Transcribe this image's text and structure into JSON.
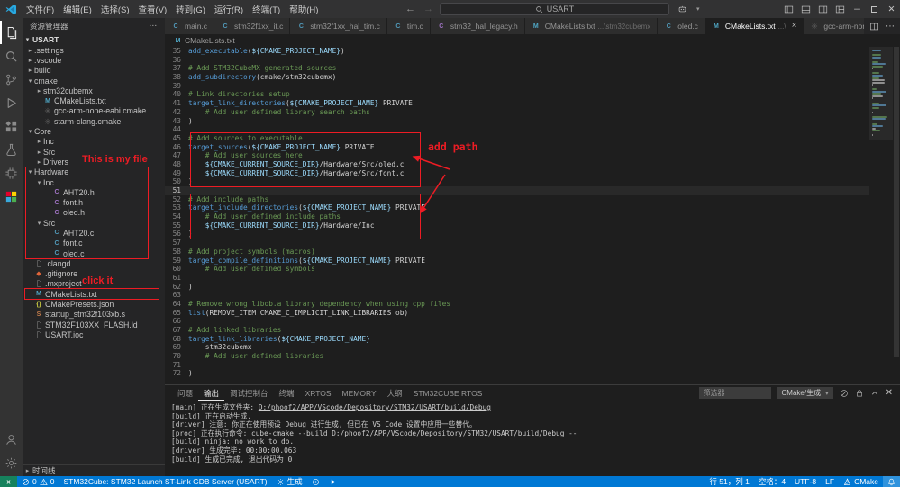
{
  "colors": {
    "annotation_red": "#ed1c24",
    "statusbar": "#0078d4",
    "accent": "#0078d4"
  },
  "window": {
    "menus": [
      "文件(F)",
      "编辑(E)",
      "选择(S)",
      "查看(V)",
      "转到(G)",
      "运行(R)",
      "终端(T)",
      "帮助(H)"
    ],
    "search_value": "USART"
  },
  "activity_bar": {
    "top": [
      {
        "name": "explorer",
        "active": true
      },
      {
        "name": "search"
      },
      {
        "name": "source-control"
      },
      {
        "name": "run-debug"
      },
      {
        "name": "extensions"
      },
      {
        "name": "testing"
      },
      {
        "name": "stm32-chip"
      },
      {
        "name": "stm32cube"
      }
    ],
    "bottom": [
      {
        "name": "account"
      },
      {
        "name": "settings"
      }
    ]
  },
  "sidebar": {
    "title": "资源管理器",
    "actions": "⋯",
    "section": "USART",
    "timeline_label": "时间线",
    "note_file": "This is my file",
    "note_click": "click it",
    "tree": [
      {
        "l": ".settings",
        "d": 0,
        "ch": "r"
      },
      {
        "l": ".vscode",
        "d": 0,
        "ch": "r"
      },
      {
        "l": "build",
        "d": 0,
        "ch": "r"
      },
      {
        "l": "cmake",
        "d": 0,
        "ch": "d"
      },
      {
        "l": "stm32cubemx",
        "d": 1,
        "ch": "r"
      },
      {
        "l": "CMakeLists.txt",
        "d": 1,
        "t": "cmake"
      },
      {
        "l": "gcc-arm-none-eabi.cmake",
        "d": 1,
        "t": "gear"
      },
      {
        "l": "starm-clang.cmake",
        "d": 1,
        "t": "gear"
      },
      {
        "l": "Core",
        "d": 0,
        "ch": "d"
      },
      {
        "l": "Inc",
        "d": 1,
        "ch": "r"
      },
      {
        "l": "Src",
        "d": 1,
        "ch": "r"
      },
      {
        "l": "Drivers",
        "d": 1,
        "ch": "r"
      },
      {
        "l": "Hardware",
        "d": 0,
        "ch": "d"
      },
      {
        "l": "Inc",
        "d": 1,
        "ch": "d"
      },
      {
        "l": "AHT20.h",
        "d": 2,
        "t": "h"
      },
      {
        "l": "font.h",
        "d": 2,
        "t": "h"
      },
      {
        "l": "oled.h",
        "d": 2,
        "t": "h"
      },
      {
        "l": "Src",
        "d": 1,
        "ch": "d"
      },
      {
        "l": "AHT20.c",
        "d": 2,
        "t": "c"
      },
      {
        "l": "font.c",
        "d": 2,
        "t": "c"
      },
      {
        "l": "oled.c",
        "d": 2,
        "t": "c"
      },
      {
        "l": ".clangd",
        "d": 0,
        "t": "file"
      },
      {
        "l": ".gitignore",
        "d": 0,
        "t": "git"
      },
      {
        "l": ".mxproject",
        "d": 0,
        "t": "file"
      },
      {
        "l": "CMakeLists.txt",
        "d": 0,
        "t": "cmake"
      },
      {
        "l": "CMakePresets.json",
        "d": 0,
        "t": "json"
      },
      {
        "l": "startup_stm32f103xb.s",
        "d": 0,
        "t": "asm"
      },
      {
        "l": "STM32F103XX_FLASH.ld",
        "d": 0,
        "t": "file"
      },
      {
        "l": "USART.ioc",
        "d": 0,
        "t": "file"
      }
    ]
  },
  "tabs": [
    {
      "icon": "c",
      "label": "main.c"
    },
    {
      "icon": "c",
      "label": "stm32f1xx_it.c"
    },
    {
      "icon": "c",
      "label": "stm32f1xx_hal_tim.c"
    },
    {
      "icon": "c",
      "label": "tim.c"
    },
    {
      "icon": "h",
      "label": "stm32_hal_legacy.h"
    },
    {
      "icon": "cmake",
      "label": "CMakeLists.txt",
      "suffix": "...\\stm32cubemx"
    },
    {
      "icon": "c",
      "label": "oled.c"
    },
    {
      "icon": "cmake",
      "label": "CMakeLists.txt",
      "suffix": "...\\",
      "active": true
    },
    {
      "icon": "gear",
      "label": "gcc-arm-none-eabi.cmake"
    }
  ],
  "breadcrumb": {
    "file": "CMakeLists.txt"
  },
  "editor": {
    "current_line": 51,
    "annotation": "add path",
    "lines": [
      {
        "n": 35,
        "s": [
          [
            "add_executable",
            "cmd"
          ],
          [
            "(",
            "pln"
          ],
          [
            "${CMAKE_PROJECT_NAME}",
            "var"
          ],
          [
            ")",
            "pln"
          ]
        ]
      },
      {
        "n": 36,
        "s": []
      },
      {
        "n": 37,
        "s": [
          [
            "# Add STM32CubeMX generated sources",
            "com"
          ]
        ]
      },
      {
        "n": 38,
        "s": [
          [
            "add_subdirectory",
            "cmd"
          ],
          [
            "(cmake/stm32cubemx)",
            "pln"
          ]
        ]
      },
      {
        "n": 39,
        "s": []
      },
      {
        "n": 40,
        "s": [
          [
            "# Link directories setup",
            "com"
          ]
        ]
      },
      {
        "n": 41,
        "s": [
          [
            "target_link_directories",
            "cmd"
          ],
          [
            "(",
            "pln"
          ],
          [
            "${CMAKE_PROJECT_NAME}",
            "var"
          ],
          [
            " PRIVATE",
            "pln"
          ]
        ]
      },
      {
        "n": 42,
        "s": [
          [
            "    # Add user defined library search paths",
            "com"
          ]
        ]
      },
      {
        "n": 43,
        "s": [
          [
            ")",
            "pln"
          ]
        ]
      },
      {
        "n": 44,
        "s": []
      },
      {
        "n": 45,
        "s": [
          [
            "# Add sources to executable",
            "com"
          ]
        ]
      },
      {
        "n": 46,
        "s": [
          [
            "target_sources",
            "cmd"
          ],
          [
            "(",
            "pln"
          ],
          [
            "${CMAKE_PROJECT_NAME}",
            "var"
          ],
          [
            " PRIVATE",
            "pln"
          ]
        ]
      },
      {
        "n": 47,
        "s": [
          [
            "    # Add user sources here",
            "com"
          ]
        ]
      },
      {
        "n": 48,
        "s": [
          [
            "    ",
            "pln"
          ],
          [
            "${CMAKE_CURRENT_SOURCE_DIR}",
            "var"
          ],
          [
            "/Hardware/Src/oled.c",
            "pln"
          ]
        ]
      },
      {
        "n": 49,
        "s": [
          [
            "    ",
            "pln"
          ],
          [
            "${CMAKE_CURRENT_SOURCE_DIR}",
            "var"
          ],
          [
            "/Hardware/Src/font.c",
            "pln"
          ]
        ]
      },
      {
        "n": 50,
        "s": [
          [
            ")",
            "pln"
          ]
        ]
      },
      {
        "n": 51,
        "s": []
      },
      {
        "n": 52,
        "s": [
          [
            "# Add include paths",
            "com"
          ]
        ]
      },
      {
        "n": 53,
        "s": [
          [
            "target_include_directories",
            "cmd"
          ],
          [
            "(",
            "pln"
          ],
          [
            "${CMAKE_PROJECT_NAME}",
            "var"
          ],
          [
            " PRIVATE",
            "pln"
          ]
        ]
      },
      {
        "n": 54,
        "s": [
          [
            "    # Add user defined include paths",
            "com"
          ]
        ]
      },
      {
        "n": 55,
        "s": [
          [
            "    ",
            "pln"
          ],
          [
            "${CMAKE_CURRENT_SOURCE_DIR}",
            "var"
          ],
          [
            "/Hardware/Inc",
            "pln"
          ]
        ]
      },
      {
        "n": 56,
        "s": [
          [
            ")",
            "pln"
          ]
        ]
      },
      {
        "n": 57,
        "s": []
      },
      {
        "n": 58,
        "s": [
          [
            "# Add project symbols (macros)",
            "com"
          ]
        ]
      },
      {
        "n": 59,
        "s": [
          [
            "target_compile_definitions",
            "cmd"
          ],
          [
            "(",
            "pln"
          ],
          [
            "${CMAKE_PROJECT_NAME}",
            "var"
          ],
          [
            " PRIVATE",
            "pln"
          ]
        ]
      },
      {
        "n": 60,
        "s": [
          [
            "    # Add user defined symbols",
            "com"
          ]
        ]
      },
      {
        "n": 61,
        "s": []
      },
      {
        "n": 62,
        "s": [
          [
            ")",
            "pln"
          ]
        ]
      },
      {
        "n": 63,
        "s": []
      },
      {
        "n": 64,
        "s": [
          [
            "# Remove wrong libob.a library dependency when using cpp files",
            "com"
          ]
        ]
      },
      {
        "n": 65,
        "s": [
          [
            "list",
            "cmd"
          ],
          [
            "(REMOVE_ITEM CMAKE_C_IMPLICIT_LINK_LIBRARIES ob)",
            "pln"
          ]
        ]
      },
      {
        "n": 66,
        "s": []
      },
      {
        "n": 67,
        "s": [
          [
            "# Add linked libraries",
            "com"
          ]
        ]
      },
      {
        "n": 68,
        "s": [
          [
            "target_link_libraries",
            "cmd"
          ],
          [
            "(",
            "pln"
          ],
          [
            "${CMAKE_PROJECT_NAME}",
            "var"
          ]
        ]
      },
      {
        "n": 69,
        "s": [
          [
            "    stm32cubemx",
            "pln"
          ]
        ]
      },
      {
        "n": 70,
        "s": [
          [
            "    # Add user defined libraries",
            "com"
          ]
        ]
      },
      {
        "n": 71,
        "s": []
      },
      {
        "n": 72,
        "s": [
          [
            ")",
            "pln"
          ]
        ]
      }
    ]
  },
  "panel": {
    "tabs": [
      "问题",
      "输出",
      "调试控制台",
      "终端",
      "XRTOS",
      "MEMORY",
      "大纲",
      "STM32CUBE RTOS"
    ],
    "active_tab": "输出",
    "filter_placeholder": "筛选器",
    "channel": "CMake/生成",
    "output_lines": [
      [
        [
          "[main] 正在生成文件夹: ",
          ""
        ],
        [
          "D:/phoof2/APP/VScode/Depository/STM32/USART/build/Debug",
          "link"
        ]
      ],
      [
        [
          "[build] 正在启动生成.",
          ""
        ]
      ],
      [
        [
          "[driver] 注意: 你正在使用预设 Debug 进行生成, 但已在 VS Code 设置中应用一些替代。",
          ""
        ]
      ],
      [
        [
          "[proc] 正在执行命令: cube-cmake --build ",
          ""
        ],
        [
          "D:/phoof2/APP/VScode/Depository/STM32/USART/build/Debug",
          "link"
        ],
        [
          " --",
          ""
        ]
      ],
      [
        [
          "[build] ninja: no work to do.",
          ""
        ]
      ],
      [
        [
          "[driver] 生成完毕: 00:00:00.063",
          ""
        ]
      ],
      [
        [
          "[build] 生成已完成, 退出代码为 0",
          ""
        ]
      ]
    ]
  },
  "status_bar": {
    "left": [
      {
        "name": "remote-indicator",
        "icon": "remote",
        "style": "remote"
      },
      {
        "name": "problems-indicator",
        "parts": [
          {
            "icon": "error",
            "text": "0"
          },
          {
            "icon": "warning",
            "text": "0"
          }
        ]
      },
      {
        "name": "stm32cube-launch",
        "text": "STM32Cube: STM32 Launch ST-Link GDB Server (USART)"
      },
      {
        "name": "cmake-build-button",
        "icon": "gear",
        "text": "生成"
      },
      {
        "name": "build-target-button",
        "icon": "target"
      },
      {
        "name": "debug-run-button",
        "icon": "play"
      }
    ],
    "right": [
      {
        "name": "cursor-position",
        "text": "行 51，列 1"
      },
      {
        "name": "indentation",
        "text": "空格：4"
      },
      {
        "name": "encoding",
        "text": "UTF-8"
      },
      {
        "name": "eol-indicator",
        "text": "LF"
      },
      {
        "name": "cmake-status",
        "icon": "cmake",
        "text": "CMake"
      },
      {
        "name": "notifications-bell",
        "icon": "bell",
        "style": "hl"
      }
    ]
  }
}
